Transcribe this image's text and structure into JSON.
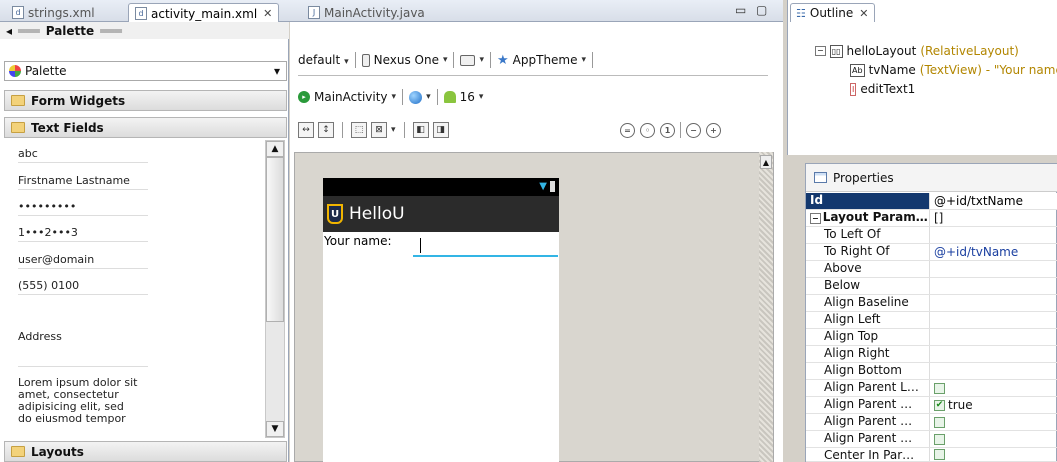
{
  "editor_tabs": [
    {
      "label": "strings.xml",
      "icon": "xml-file-icon"
    },
    {
      "label": "activity_main.xml",
      "icon": "xml-file-icon"
    },
    {
      "label": "MainActivity.java",
      "icon": "java-file-icon"
    }
  ],
  "palette": {
    "title": "Palette",
    "select_value": "Palette",
    "categories": {
      "form_widgets": "Form Widgets",
      "text_fields": "Text Fields",
      "layouts": "Layouts"
    },
    "text_field_items": [
      "abc",
      "Firstname Lastname",
      "•••••••••",
      "1•••2•••3",
      "user@domain",
      "(555) 0100",
      "Address",
      "Lorem ipsum dolor sit",
      "amet, consectetur",
      "adipisicing elit, sed",
      "do eiusmod tempor"
    ]
  },
  "toolbar": {
    "config": "default",
    "device": "Nexus One",
    "theme": "AppTheme",
    "activity": "MainActivity",
    "api_level": "16"
  },
  "device_preview": {
    "app_title": "HelloU",
    "app_logo_letter": "U",
    "label_text": "Your name:"
  },
  "outline": {
    "tab_label": "Outline",
    "root": {
      "name": "helloLayout",
      "type": "(RelativeLayout)"
    },
    "children": [
      {
        "icon_text": "Ab",
        "name": "tvName",
        "type": "(TextView) - \"Your name"
      },
      {
        "icon_text": "I",
        "name": "editText1",
        "type": ""
      }
    ]
  },
  "properties": {
    "tab_label": "Properties",
    "rows": [
      {
        "name": "Id",
        "value": "@+id/txtName"
      },
      {
        "name": "Layout Param…",
        "value": "[]"
      },
      {
        "name": "To Left Of",
        "value": ""
      },
      {
        "name": "To Right Of",
        "value": "@+id/tvName"
      },
      {
        "name": "Above",
        "value": ""
      },
      {
        "name": "Below",
        "value": ""
      },
      {
        "name": "Align Baseline",
        "value": ""
      },
      {
        "name": "Align Left",
        "value": ""
      },
      {
        "name": "Align Top",
        "value": ""
      },
      {
        "name": "Align Right",
        "value": ""
      },
      {
        "name": "Align Bottom",
        "value": ""
      },
      {
        "name": "Align Parent L…",
        "value": ""
      },
      {
        "name": "Align Parent …",
        "value": "true"
      },
      {
        "name": "Align Parent …",
        "value": ""
      },
      {
        "name": "Align Parent …",
        "value": ""
      },
      {
        "name": "Center In Par…",
        "value": ""
      }
    ]
  },
  "colors": {
    "accent_blue": "#33b5e5",
    "header_navy": "#13386e",
    "type_gold": "#b28600"
  }
}
